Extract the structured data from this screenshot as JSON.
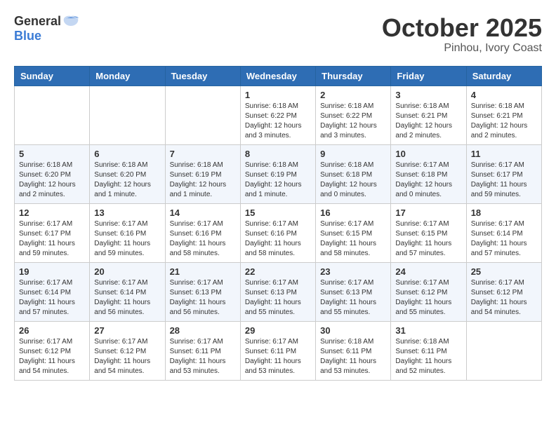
{
  "header": {
    "logo_general": "General",
    "logo_blue": "Blue",
    "month": "October 2025",
    "location": "Pinhou, Ivory Coast"
  },
  "weekdays": [
    "Sunday",
    "Monday",
    "Tuesday",
    "Wednesday",
    "Thursday",
    "Friday",
    "Saturday"
  ],
  "weeks": [
    [
      {
        "day": "",
        "info": ""
      },
      {
        "day": "",
        "info": ""
      },
      {
        "day": "",
        "info": ""
      },
      {
        "day": "1",
        "info": "Sunrise: 6:18 AM\nSunset: 6:22 PM\nDaylight: 12 hours\nand 3 minutes."
      },
      {
        "day": "2",
        "info": "Sunrise: 6:18 AM\nSunset: 6:22 PM\nDaylight: 12 hours\nand 3 minutes."
      },
      {
        "day": "3",
        "info": "Sunrise: 6:18 AM\nSunset: 6:21 PM\nDaylight: 12 hours\nand 2 minutes."
      },
      {
        "day": "4",
        "info": "Sunrise: 6:18 AM\nSunset: 6:21 PM\nDaylight: 12 hours\nand 2 minutes."
      }
    ],
    [
      {
        "day": "5",
        "info": "Sunrise: 6:18 AM\nSunset: 6:20 PM\nDaylight: 12 hours\nand 2 minutes."
      },
      {
        "day": "6",
        "info": "Sunrise: 6:18 AM\nSunset: 6:20 PM\nDaylight: 12 hours\nand 1 minute."
      },
      {
        "day": "7",
        "info": "Sunrise: 6:18 AM\nSunset: 6:19 PM\nDaylight: 12 hours\nand 1 minute."
      },
      {
        "day": "8",
        "info": "Sunrise: 6:18 AM\nSunset: 6:19 PM\nDaylight: 12 hours\nand 1 minute."
      },
      {
        "day": "9",
        "info": "Sunrise: 6:18 AM\nSunset: 6:18 PM\nDaylight: 12 hours\nand 0 minutes."
      },
      {
        "day": "10",
        "info": "Sunrise: 6:17 AM\nSunset: 6:18 PM\nDaylight: 12 hours\nand 0 minutes."
      },
      {
        "day": "11",
        "info": "Sunrise: 6:17 AM\nSunset: 6:17 PM\nDaylight: 11 hours\nand 59 minutes."
      }
    ],
    [
      {
        "day": "12",
        "info": "Sunrise: 6:17 AM\nSunset: 6:17 PM\nDaylight: 11 hours\nand 59 minutes."
      },
      {
        "day": "13",
        "info": "Sunrise: 6:17 AM\nSunset: 6:16 PM\nDaylight: 11 hours\nand 59 minutes."
      },
      {
        "day": "14",
        "info": "Sunrise: 6:17 AM\nSunset: 6:16 PM\nDaylight: 11 hours\nand 58 minutes."
      },
      {
        "day": "15",
        "info": "Sunrise: 6:17 AM\nSunset: 6:16 PM\nDaylight: 11 hours\nand 58 minutes."
      },
      {
        "day": "16",
        "info": "Sunrise: 6:17 AM\nSunset: 6:15 PM\nDaylight: 11 hours\nand 58 minutes."
      },
      {
        "day": "17",
        "info": "Sunrise: 6:17 AM\nSunset: 6:15 PM\nDaylight: 11 hours\nand 57 minutes."
      },
      {
        "day": "18",
        "info": "Sunrise: 6:17 AM\nSunset: 6:14 PM\nDaylight: 11 hours\nand 57 minutes."
      }
    ],
    [
      {
        "day": "19",
        "info": "Sunrise: 6:17 AM\nSunset: 6:14 PM\nDaylight: 11 hours\nand 57 minutes."
      },
      {
        "day": "20",
        "info": "Sunrise: 6:17 AM\nSunset: 6:14 PM\nDaylight: 11 hours\nand 56 minutes."
      },
      {
        "day": "21",
        "info": "Sunrise: 6:17 AM\nSunset: 6:13 PM\nDaylight: 11 hours\nand 56 minutes."
      },
      {
        "day": "22",
        "info": "Sunrise: 6:17 AM\nSunset: 6:13 PM\nDaylight: 11 hours\nand 55 minutes."
      },
      {
        "day": "23",
        "info": "Sunrise: 6:17 AM\nSunset: 6:13 PM\nDaylight: 11 hours\nand 55 minutes."
      },
      {
        "day": "24",
        "info": "Sunrise: 6:17 AM\nSunset: 6:12 PM\nDaylight: 11 hours\nand 55 minutes."
      },
      {
        "day": "25",
        "info": "Sunrise: 6:17 AM\nSunset: 6:12 PM\nDaylight: 11 hours\nand 54 minutes."
      }
    ],
    [
      {
        "day": "26",
        "info": "Sunrise: 6:17 AM\nSunset: 6:12 PM\nDaylight: 11 hours\nand 54 minutes."
      },
      {
        "day": "27",
        "info": "Sunrise: 6:17 AM\nSunset: 6:12 PM\nDaylight: 11 hours\nand 54 minutes."
      },
      {
        "day": "28",
        "info": "Sunrise: 6:17 AM\nSunset: 6:11 PM\nDaylight: 11 hours\nand 53 minutes."
      },
      {
        "day": "29",
        "info": "Sunrise: 6:17 AM\nSunset: 6:11 PM\nDaylight: 11 hours\nand 53 minutes."
      },
      {
        "day": "30",
        "info": "Sunrise: 6:18 AM\nSunset: 6:11 PM\nDaylight: 11 hours\nand 53 minutes."
      },
      {
        "day": "31",
        "info": "Sunrise: 6:18 AM\nSunset: 6:11 PM\nDaylight: 11 hours\nand 52 minutes."
      },
      {
        "day": "",
        "info": ""
      }
    ]
  ]
}
